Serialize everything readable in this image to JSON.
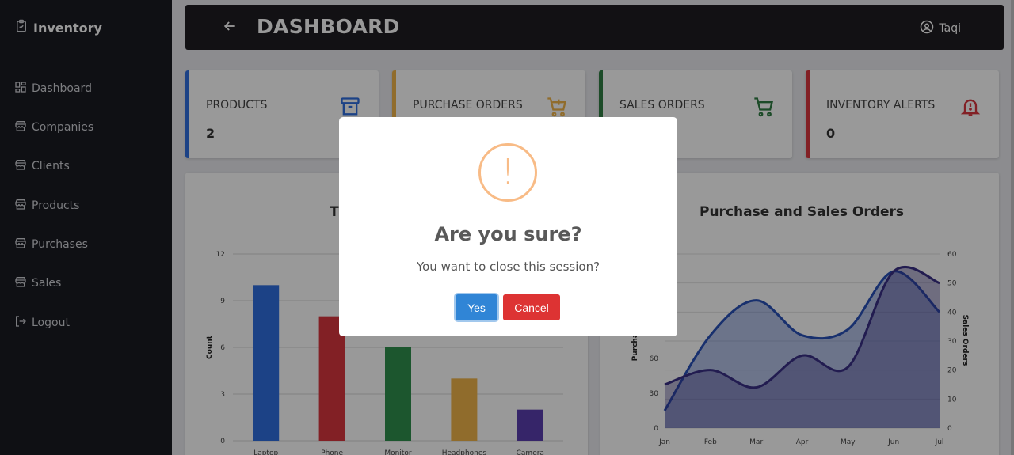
{
  "sidebar": {
    "brand": "Inventory",
    "items": [
      {
        "label": "Dashboard",
        "icon": "dashboard-icon"
      },
      {
        "label": "Companies",
        "icon": "store-icon"
      },
      {
        "label": "Clients",
        "icon": "store-icon"
      },
      {
        "label": "Products",
        "icon": "store-icon"
      },
      {
        "label": "Purchases",
        "icon": "store-icon"
      },
      {
        "label": "Sales",
        "icon": "store-icon"
      },
      {
        "label": "Logout",
        "icon": "logout-icon"
      }
    ]
  },
  "header": {
    "title": "DASHBOARD",
    "user": "Taqi"
  },
  "cards": [
    {
      "label": "PRODUCTS",
      "value": "2",
      "color": "#2f6fe0",
      "icon": "archive-icon"
    },
    {
      "label": "PURCHASE ORDERS",
      "value": "",
      "color": "#f0b54a",
      "icon": "cart-plus-icon"
    },
    {
      "label": "SALES ORDERS",
      "value": "",
      "color": "#2f7d43",
      "icon": "cart-icon"
    },
    {
      "label": "INVENTORY ALERTS",
      "value": "0",
      "color": "#d9363e",
      "icon": "bell-alert-icon"
    }
  ],
  "charts": {
    "left_title_visible": "T",
    "right_title": "Purchase and Sales Orders"
  },
  "chart_data": [
    {
      "type": "bar",
      "title": "",
      "ylabel": "Count",
      "xlabel": "",
      "categories": [
        "Laptop",
        "Phone",
        "Monitor",
        "Headphones",
        "Camera"
      ],
      "values": [
        10,
        8,
        6,
        4,
        2
      ],
      "colors": [
        "#2f6fe0",
        "#d9363e",
        "#2f8f4e",
        "#f0b54a",
        "#5b3fb0"
      ],
      "ylim": [
        0,
        12
      ],
      "yticks": [
        0,
        3,
        6,
        9,
        12
      ]
    },
    {
      "type": "area",
      "title": "Purchase and Sales Orders",
      "x": [
        "Jan",
        "Feb",
        "Mar",
        "Apr",
        "May",
        "Jun",
        "Jul"
      ],
      "ylabel_left": "Purchase",
      "ylabel_right": "Sales Orders",
      "series": [
        {
          "axis": "left",
          "color": "#2850b8",
          "values": [
            15,
            80,
            110,
            80,
            85,
            135,
            100
          ]
        },
        {
          "axis": "right",
          "color": "#3a2f85",
          "values": [
            15,
            20,
            14,
            25,
            21,
            54,
            50
          ]
        }
      ],
      "ylim_left": [
        0,
        150
      ],
      "yticks_left": [
        0,
        30,
        60
      ],
      "ylim_right": [
        0,
        60
      ],
      "yticks_right": [
        0,
        10,
        20,
        30,
        40,
        50,
        60
      ]
    }
  ],
  "modal": {
    "icon_glyph": "!",
    "title": "Are you sure?",
    "text": "You want to close this session?",
    "confirm_label": "Yes",
    "cancel_label": "Cancel",
    "confirm_color": "#3085d6",
    "cancel_color": "#dd3333"
  }
}
